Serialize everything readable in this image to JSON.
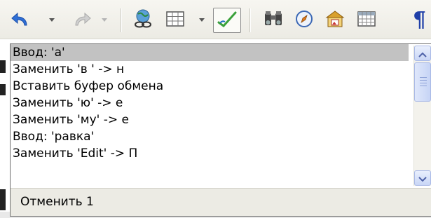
{
  "toolbar": {
    "buttons": [
      {
        "name": "undo",
        "icon": "undo-icon",
        "has_dropdown": true,
        "enabled": true
      },
      {
        "name": "redo",
        "icon": "redo-icon",
        "has_dropdown": true,
        "enabled": false
      },
      {
        "name": "hyperlink",
        "icon": "globe-link-icon"
      },
      {
        "name": "table",
        "icon": "table-icon",
        "has_dropdown": true
      },
      {
        "name": "draw-functions",
        "icon": "pencil-check-icon",
        "pressed": true
      },
      {
        "name": "find-replace",
        "icon": "binoculars-icon"
      },
      {
        "name": "navigator",
        "icon": "compass-icon"
      },
      {
        "name": "gallery",
        "icon": "gallery-icon"
      },
      {
        "name": "data-sources",
        "icon": "grid-icon"
      },
      {
        "name": "formatting-marks",
        "icon": "pilcrow-icon",
        "glyph": "¶"
      }
    ],
    "colors": {
      "undo_accent": "#2f6fd6",
      "redo_disabled": "#b9b9b9",
      "pencil_green": "#3aa13a",
      "pilcrow_blue": "#1f3fa8"
    }
  },
  "undo_list": {
    "items": [
      {
        "label": "Ввод: 'а'",
        "selected": true
      },
      {
        "label": "Заменить 'в ' -> н",
        "selected": false
      },
      {
        "label": "Вставить буфер обмена",
        "selected": false
      },
      {
        "label": "Заменить 'ю' -> е",
        "selected": false
      },
      {
        "label": "Заменить 'му' -> е",
        "selected": false
      },
      {
        "label": "Ввод: 'равка'",
        "selected": false
      },
      {
        "label": "Заменить 'Edit' -> П",
        "selected": false
      }
    ],
    "status_text": "Отменить 1"
  }
}
